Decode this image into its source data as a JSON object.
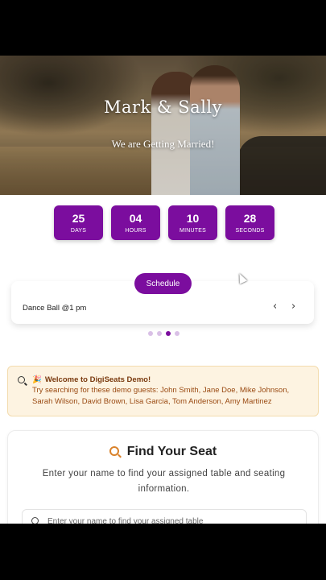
{
  "hero": {
    "title": "Mark & Sally",
    "subtitle": "We are Getting Married!"
  },
  "countdown": [
    {
      "value": "25",
      "label": "DAYS"
    },
    {
      "value": "04",
      "label": "HOURS"
    },
    {
      "value": "10",
      "label": "MINUTES"
    },
    {
      "value": "28",
      "label": "SECONDS"
    }
  ],
  "schedule": {
    "button_label": "Schedule",
    "event": "Dance Ball @1 pm",
    "prev_icon": "‹",
    "next_icon": "›",
    "dots": 4,
    "active_dot": 2
  },
  "notice": {
    "emoji": "🎉",
    "title": "Welcome to DigiSeats Demo!",
    "text": "Try searching for these demo guests: John Smith, Jane Doe, Mike Johnson, Sarah Wilson, David Brown, Lisa Garcia, Tom Anderson, Amy Martinez"
  },
  "find_seat": {
    "title": "Find Your Seat",
    "description": "Enter your name to find your assigned table and seating information.",
    "search_placeholder": "Enter your name to find your assigned table"
  },
  "colors": {
    "accent": "#7b0d9e",
    "notice_bg": "#fdf3e1",
    "notice_text": "#9a4a12",
    "search_icon_accent": "#d9822b"
  }
}
